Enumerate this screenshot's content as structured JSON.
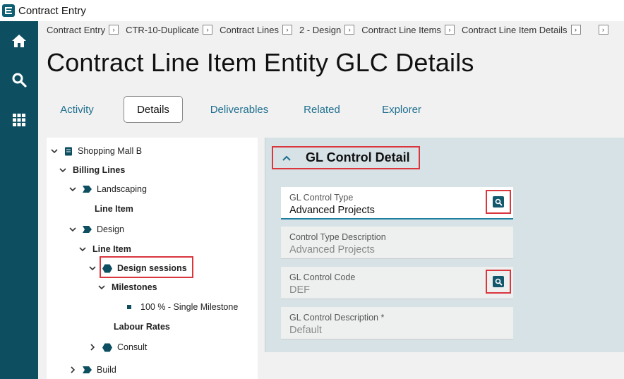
{
  "app": {
    "title": "Contract Entry"
  },
  "nav": [
    {
      "name": "home-icon"
    },
    {
      "name": "search-icon"
    },
    {
      "name": "apps-grid-icon"
    }
  ],
  "breadcrumb": [
    "Contract Entry",
    "CTR-10-Duplicate",
    "Contract Lines",
    "2 - Design",
    "Contract Line Items",
    "Contract Line Item Details"
  ],
  "page": {
    "title": "Contract Line Item Entity GLC Details"
  },
  "tabs": [
    "Activity",
    "Details",
    "Deliverables",
    "Related",
    "Explorer"
  ],
  "active_tab": "Details",
  "tree": {
    "root": "Shopping Mall B",
    "billing_lines": "Billing Lines",
    "landscaping": "Landscaping",
    "landscaping_line_item": "Line Item",
    "design": "Design",
    "design_line_item": "Line Item",
    "design_sessions": "Design sessions",
    "milestones": "Milestones",
    "milestone_item": "100 % - Single Milestone",
    "labour_rates": "Labour Rates",
    "consult": "Consult",
    "build": "Build"
  },
  "section": {
    "title": "GL Control Detail"
  },
  "fields": {
    "gl_control_type": {
      "label": "GL Control Type",
      "value": "Advanced Projects"
    },
    "control_type_description": {
      "label": "Control Type Description",
      "value": "Advanced Projects"
    },
    "gl_control_code": {
      "label": "GL Control Code",
      "value": "DEF"
    },
    "gl_control_description": {
      "label": "GL Control Description *",
      "value": "Default"
    }
  },
  "colors": {
    "nav_bg": "#0d4f61",
    "accent": "#1e6f8e",
    "highlight": "#d9363e"
  }
}
